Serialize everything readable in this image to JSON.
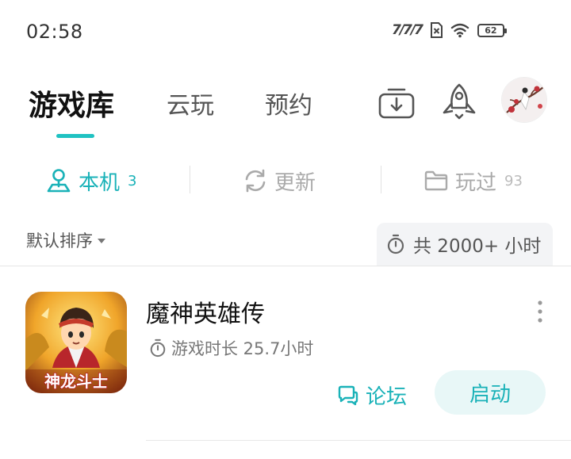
{
  "status_bar": {
    "time": "02:58",
    "signal_label": "7/7/7",
    "battery_level": "62",
    "icons": [
      "signal-icon",
      "sim-no-service-icon",
      "wifi-icon",
      "battery-icon"
    ]
  },
  "header": {
    "tabs": [
      {
        "label": "游戏库",
        "active": true
      },
      {
        "label": "云玩",
        "active": false
      },
      {
        "label": "预约",
        "active": false
      }
    ],
    "icons": [
      "download-icon",
      "rocket-icon",
      "avatar"
    ]
  },
  "subtabs": [
    {
      "label": "本机",
      "count": "3",
      "icon": "local-device-icon",
      "active": true
    },
    {
      "label": "更新",
      "count": "",
      "icon": "refresh-icon",
      "active": false
    },
    {
      "label": "玩过",
      "count": "93",
      "icon": "folder-icon",
      "active": false
    }
  ],
  "sort": {
    "label": "默认排序"
  },
  "total_time": {
    "label": "共 2000+ 小时"
  },
  "games": [
    {
      "title": "魔神英雄传",
      "play_time": "游戏时长 25.7小时",
      "icon_text": "神龙斗士",
      "forum_label": "论坛",
      "launch_label": "启动"
    }
  ],
  "colors": {
    "accent": "#1ab2b8",
    "tab_underline": "#1fc2c2",
    "launch_bg": "#e8f7f7"
  }
}
